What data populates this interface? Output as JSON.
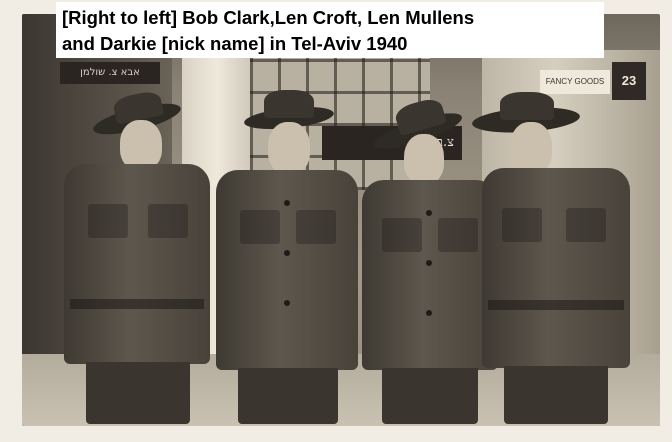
{
  "caption": {
    "line1": "[Right to left] Bob Clark,Len Croft, Len Mullens",
    "line2": "and Darkie [nick name] in Tel-Aviv 1940"
  },
  "photo": {
    "left_sign_text": "אבא צ. שולמן",
    "shop_sign_text": "צ.בליקוב 23",
    "fancy_goods_text": "FANCY GOODS",
    "house_number": "23"
  },
  "colors": {
    "mount": "#f1ede4",
    "uniform": "#4a443b",
    "caption_background": "#ffffff",
    "caption_text": "#000000"
  }
}
